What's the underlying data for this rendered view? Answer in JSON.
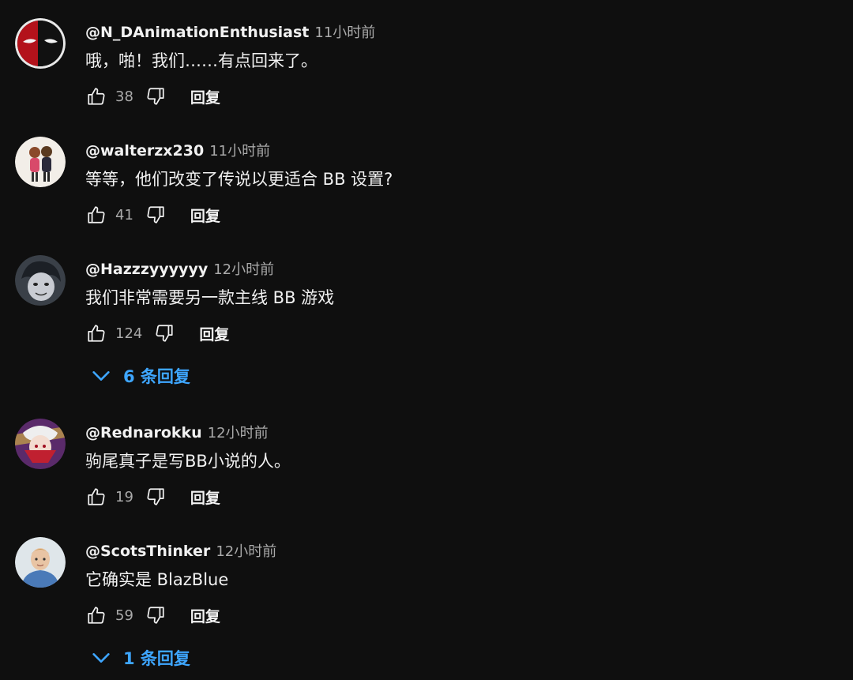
{
  "comments": [
    {
      "author": "@N_DAnimationEnthusiast",
      "time": "11小时前",
      "text": "哦，啪！我们……有点回来了。",
      "likes": "38",
      "reply_label": "回复",
      "avatar_icon": "deadpool-mask-avatar"
    },
    {
      "author": "@walterzx230",
      "time": "11小时前",
      "text": "等等，他们改变了传说以更适合 BB 设置?",
      "likes": "41",
      "reply_label": "回复",
      "avatar_icon": "anime-characters-avatar"
    },
    {
      "author": "@Hazzzyyyyyy",
      "time": "12小时前",
      "text": "我们非常需要另一款主线 BB 游戏",
      "likes": "124",
      "reply_label": "回复",
      "avatar_icon": "anime-face-avatar",
      "replies_label": "6 条回复"
    },
    {
      "author": "@Rednarokku",
      "time": "12小时前",
      "text": "驹尾真子是写BB小说的人。",
      "likes": "19",
      "reply_label": "回复",
      "avatar_icon": "anime-character-avatar"
    },
    {
      "author": "@ScotsThinker",
      "time": "12小时前",
      "text": "它确实是 BlazBlue",
      "likes": "59",
      "reply_label": "回复",
      "avatar_icon": "portrait-avatar",
      "replies_label": "1 条回复"
    }
  ],
  "colors": {
    "background": "#0f0f0f",
    "text": "#f1f1f1",
    "secondary": "#aaaaaa",
    "accent": "#3ea6ff"
  }
}
